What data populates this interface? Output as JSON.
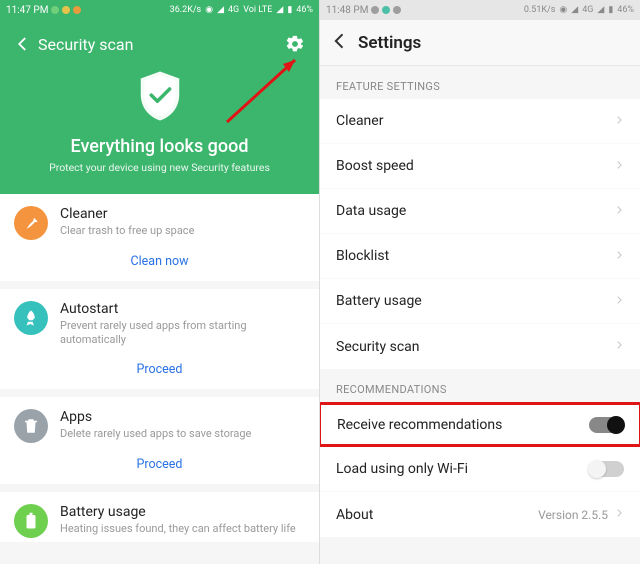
{
  "left": {
    "status": {
      "time": "11:47 PM",
      "speed": "36.2K/s",
      "net": "4G",
      "carrier": "Voi LTE",
      "battery": "46%"
    },
    "header": {
      "title": "Security scan"
    },
    "hero": {
      "heading": "Everything looks good",
      "sub": "Protect your device using new Security features"
    },
    "cards": [
      {
        "icon": "broom",
        "color": "ic-orange",
        "title": "Cleaner",
        "sub": "Clear trash to free up space",
        "action": "Clean now"
      },
      {
        "icon": "rocket",
        "color": "ic-teal",
        "title": "Autostart",
        "sub": "Prevent rarely used apps from starting automatically",
        "action": "Proceed"
      },
      {
        "icon": "trash",
        "color": "ic-grey",
        "title": "Apps",
        "sub": "Delete rarely used apps to save storage",
        "action": "Proceed"
      },
      {
        "icon": "battery",
        "color": "ic-green",
        "title": "Battery usage",
        "sub": "Heating issues found, they can affect battery life",
        "action": ""
      }
    ]
  },
  "right": {
    "status": {
      "time": "11:48 PM",
      "speed": "0.51K/s",
      "net": "4G",
      "battery": "46%"
    },
    "header": {
      "title": "Settings"
    },
    "sections": {
      "feature_label": "FEATURE SETTINGS",
      "features": [
        {
          "label": "Cleaner"
        },
        {
          "label": "Boost speed"
        },
        {
          "label": "Data usage"
        },
        {
          "label": "Blocklist"
        },
        {
          "label": "Battery usage"
        },
        {
          "label": "Security scan"
        }
      ],
      "rec_label": "RECOMMENDATIONS",
      "recs": {
        "receive": "Receive recommendations",
        "wifi": "Load using only Wi-Fi",
        "about": "About",
        "version": "Version 2.5.5"
      }
    }
  }
}
